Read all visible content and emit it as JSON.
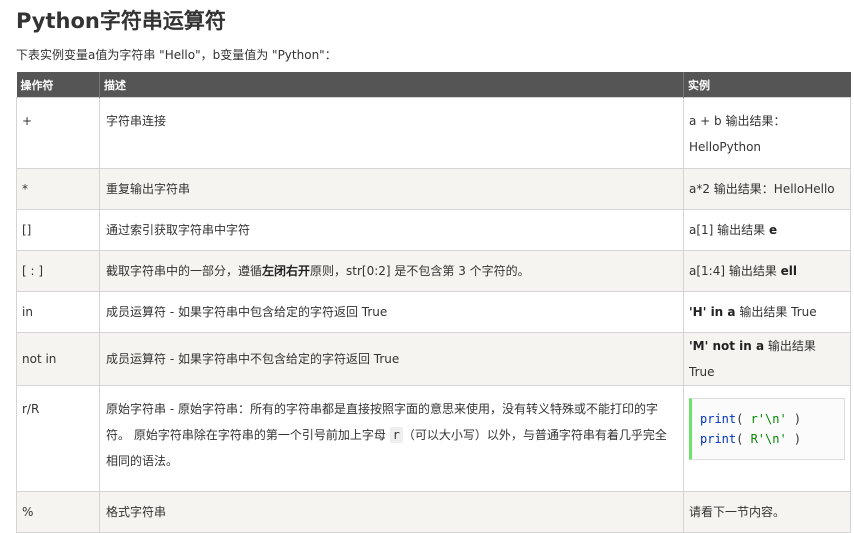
{
  "page": {
    "title": "Python字符串运算符",
    "intro": "下表实例变量a值为字符串 \"Hello\"，b变量值为 \"Python\"："
  },
  "table": {
    "headers": [
      "操作符",
      "描述",
      "实例"
    ],
    "rows": [
      {
        "op": "+",
        "desc": "字符串连接",
        "ex_line1": "a + b 输出结果：",
        "ex_line2": "HelloPython"
      },
      {
        "op": "*",
        "desc": "重复输出字符串",
        "ex": "a*2 输出结果：HelloHello"
      },
      {
        "op": "[]",
        "desc": "通过索引获取字符串中字符",
        "ex_prefix": "a[1] 输出结果 ",
        "ex_bold": "e"
      },
      {
        "op": "[ : ]",
        "desc_prefix": "截取字符串中的一部分，遵循",
        "desc_bold": "左闭右开",
        "desc_suffix": "原则，str[0:2] 是不包含第 3 个字符的。",
        "ex_prefix": "a[1:4] 输出结果 ",
        "ex_bold": "ell"
      },
      {
        "op": "in",
        "desc": "成员运算符 - 如果字符串中包含给定的字符返回 True",
        "ex_bold": "'H' in a",
        "ex_suffix": " 输出结果 True"
      },
      {
        "op": "not in",
        "desc": "成员运算符 - 如果字符串中不包含给定的字符返回 True",
        "ex_bold": "'M' not in a",
        "ex_suffix": " 输出结果 True"
      },
      {
        "op": "r/R",
        "desc_part1": "原始字符串 - 原始字符串：所有的字符串都是直接按照字面的意思来使用，没有转义特殊或不能打印的字符。 原始字符串除在字符串的第一个引号前加上字母 ",
        "desc_code": "r",
        "desc_part2": "（可以大小写）以外，与普通字符串有着几乎完全相同的语法。",
        "code": {
          "line1_fn": "print",
          "line1_open": "( ",
          "line1_str": "r'\\n'",
          "line1_close": " )",
          "line2_fn": "print",
          "line2_open": "( ",
          "line2_str": "R'\\n'",
          "line2_close": " )"
        }
      },
      {
        "op": "%",
        "desc": "格式字符串",
        "ex": "请看下一节内容。"
      }
    ]
  },
  "colors": {
    "header_bg": "#555555",
    "alt_row_bg": "#f6f4f0",
    "border": "#d4d4d4",
    "code_accent": "#6ce26c",
    "code_keyword": "#0033bb",
    "code_string": "#008800"
  }
}
